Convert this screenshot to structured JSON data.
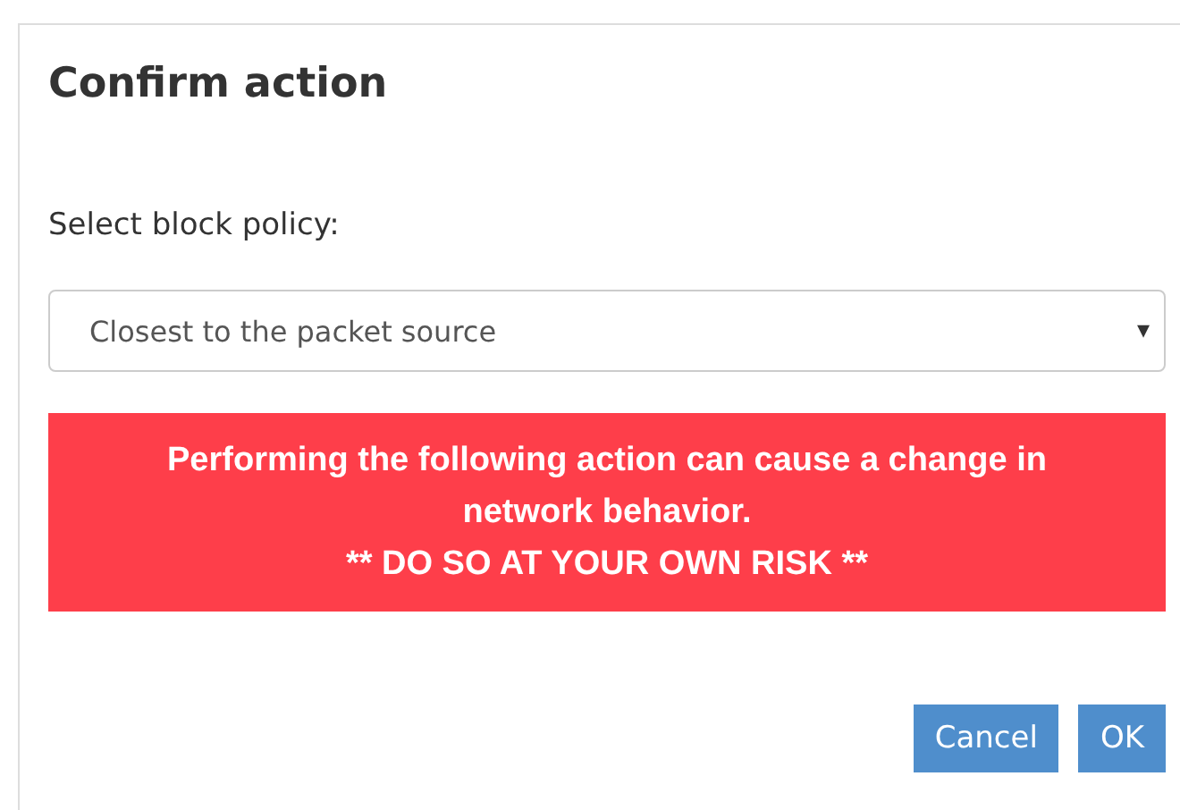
{
  "dialog": {
    "title": "Confirm action",
    "field": {
      "label": "Select block policy:",
      "value": "Closest to the packet source",
      "arrow": "▾"
    },
    "warning": {
      "lines": [
        "Performing the following action can cause a change in network behavior.",
        "** DO SO AT YOUR OWN RISK **"
      ]
    },
    "buttons": [
      {
        "label": "Cancel"
      },
      {
        "label": "OK"
      }
    ]
  }
}
